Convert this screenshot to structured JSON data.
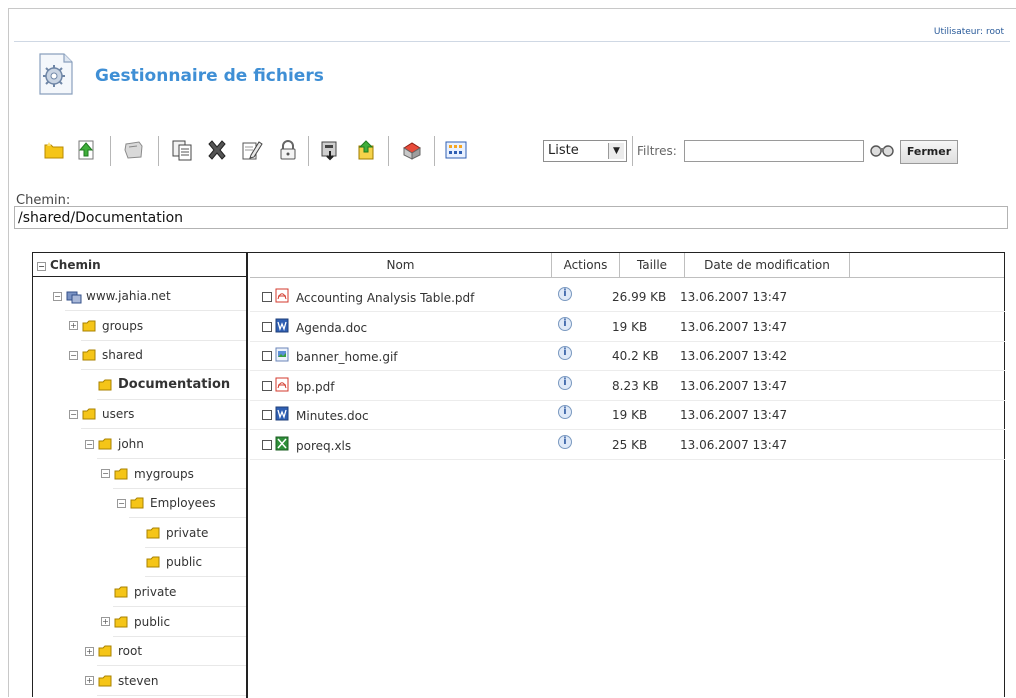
{
  "header": {
    "user_text": "Utilisateur: root",
    "app_title": "Gestionnaire de fichiers"
  },
  "toolbar": {
    "icons": [
      "new-folder-icon",
      "upload-icon",
      "mount-icon",
      "copy-icon",
      "delete-icon",
      "rename-icon",
      "lock-icon",
      "download-icon",
      "unzip-icon",
      "zip-icon",
      "view-icon"
    ],
    "view_label": "Liste",
    "filter_label": "Filtres:",
    "filter_value": "",
    "close_label": "Fermer"
  },
  "path": {
    "label": "Chemin:",
    "value": "/shared/Documentation"
  },
  "tree": {
    "header": "Chemin",
    "items": [
      {
        "label": "www.jahia.net",
        "level": 0,
        "expander": "⊟",
        "bold": false,
        "type": "site"
      },
      {
        "label": "groups",
        "level": 1,
        "expander": "⊞",
        "bold": false,
        "type": "folder"
      },
      {
        "label": "shared",
        "level": 1,
        "expander": "⊟",
        "bold": false,
        "type": "folder"
      },
      {
        "label": "Documentation",
        "level": 2,
        "expander": "",
        "bold": true,
        "type": "folder"
      },
      {
        "label": "users",
        "level": 1,
        "expander": "⊟",
        "bold": false,
        "type": "folder"
      },
      {
        "label": "john",
        "level": 2,
        "expander": "⊟",
        "bold": false,
        "type": "folder"
      },
      {
        "label": "mygroups",
        "level": 3,
        "expander": "⊟",
        "bold": false,
        "type": "folder"
      },
      {
        "label": "Employees",
        "level": 4,
        "expander": "⊟",
        "bold": false,
        "type": "folder"
      },
      {
        "label": "private",
        "level": 5,
        "expander": "",
        "bold": false,
        "type": "folder"
      },
      {
        "label": "public",
        "level": 5,
        "expander": "",
        "bold": false,
        "type": "folder"
      },
      {
        "label": "private",
        "level": 3,
        "expander": "",
        "bold": false,
        "type": "folder"
      },
      {
        "label": "public",
        "level": 3,
        "expander": "⊞",
        "bold": false,
        "type": "folder"
      },
      {
        "label": "root",
        "level": 2,
        "expander": "⊞",
        "bold": false,
        "type": "folder"
      },
      {
        "label": "steven",
        "level": 2,
        "expander": "⊞",
        "bold": false,
        "type": "folder"
      }
    ]
  },
  "grid": {
    "columns": [
      "Nom",
      "Actions",
      "Taille",
      "Date de modification"
    ],
    "rows": [
      {
        "name": "Accounting Analysis Table.pdf",
        "type": "pdf",
        "size": "26.99 KB",
        "date": "13.06.2007 13:47"
      },
      {
        "name": "Agenda.doc",
        "type": "doc",
        "size": "19 KB",
        "date": "13.06.2007 13:47"
      },
      {
        "name": "banner_home.gif",
        "type": "gif",
        "size": "40.2 KB",
        "date": "13.06.2007 13:42"
      },
      {
        "name": "bp.pdf",
        "type": "pdf",
        "size": "8.23 KB",
        "date": "13.06.2007 13:47"
      },
      {
        "name": "Minutes.doc",
        "type": "doc",
        "size": "19 KB",
        "date": "13.06.2007 13:47"
      },
      {
        "name": "poreq.xls",
        "type": "xls",
        "size": "25 KB",
        "date": "13.06.2007 13:47"
      }
    ]
  },
  "colors": {
    "title": "#3f8fd5",
    "user_text": "#2a5b9a",
    "folder": "#f5c518",
    "pdf": "#d33a2c",
    "doc": "#2f5fb3",
    "xls": "#2f8f3a"
  }
}
